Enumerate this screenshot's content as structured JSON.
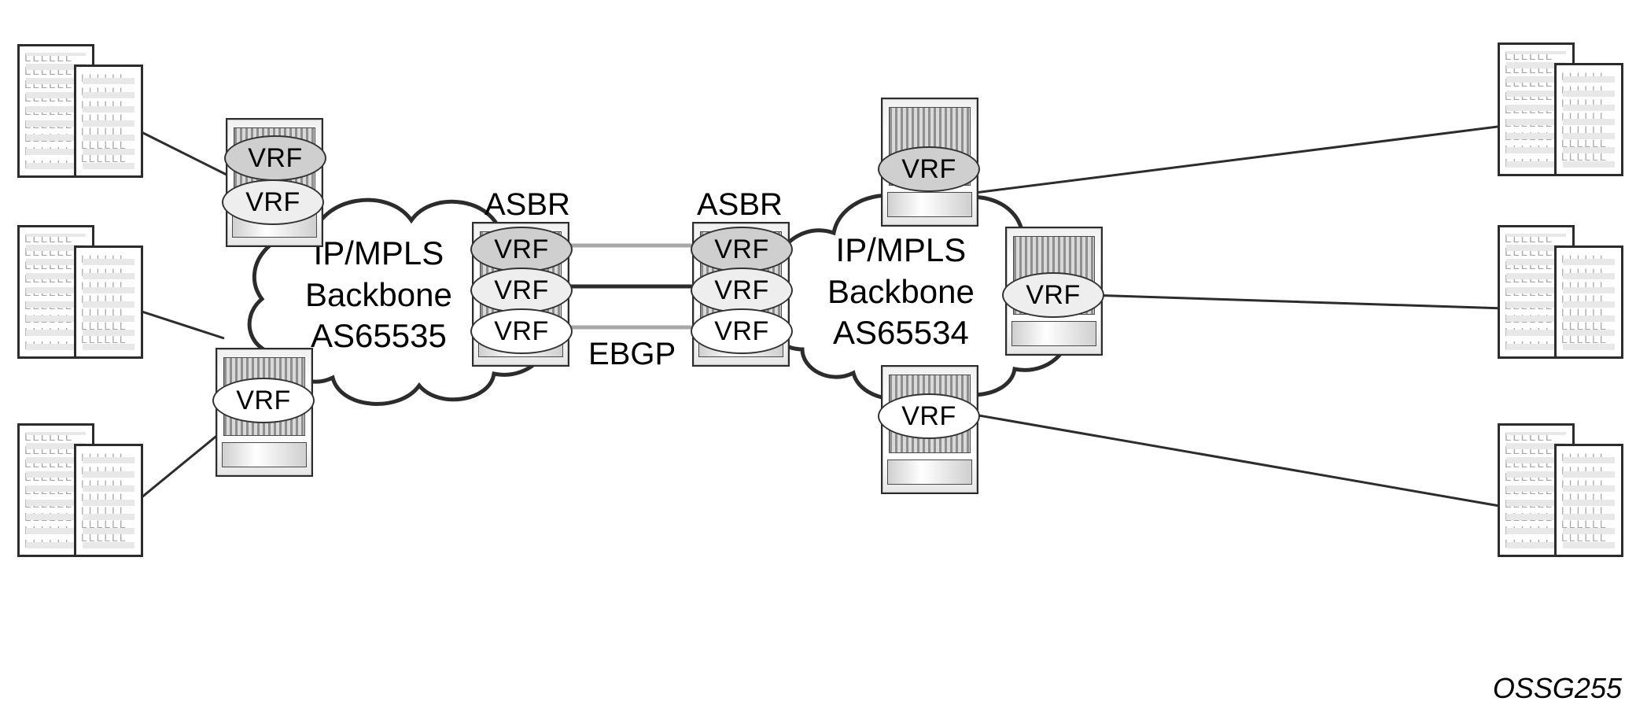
{
  "labels": {
    "vrf": "VRF",
    "asbr": "ASBR",
    "ebgp": "EBGP",
    "footer": "OSSG255"
  },
  "clouds": {
    "left": {
      "title": "IP/MPLS",
      "subtitle": "Backbone",
      "as": "AS65535"
    },
    "right": {
      "title": "IP/MPLS",
      "subtitle": "Backbone",
      "as": "AS65534"
    }
  }
}
